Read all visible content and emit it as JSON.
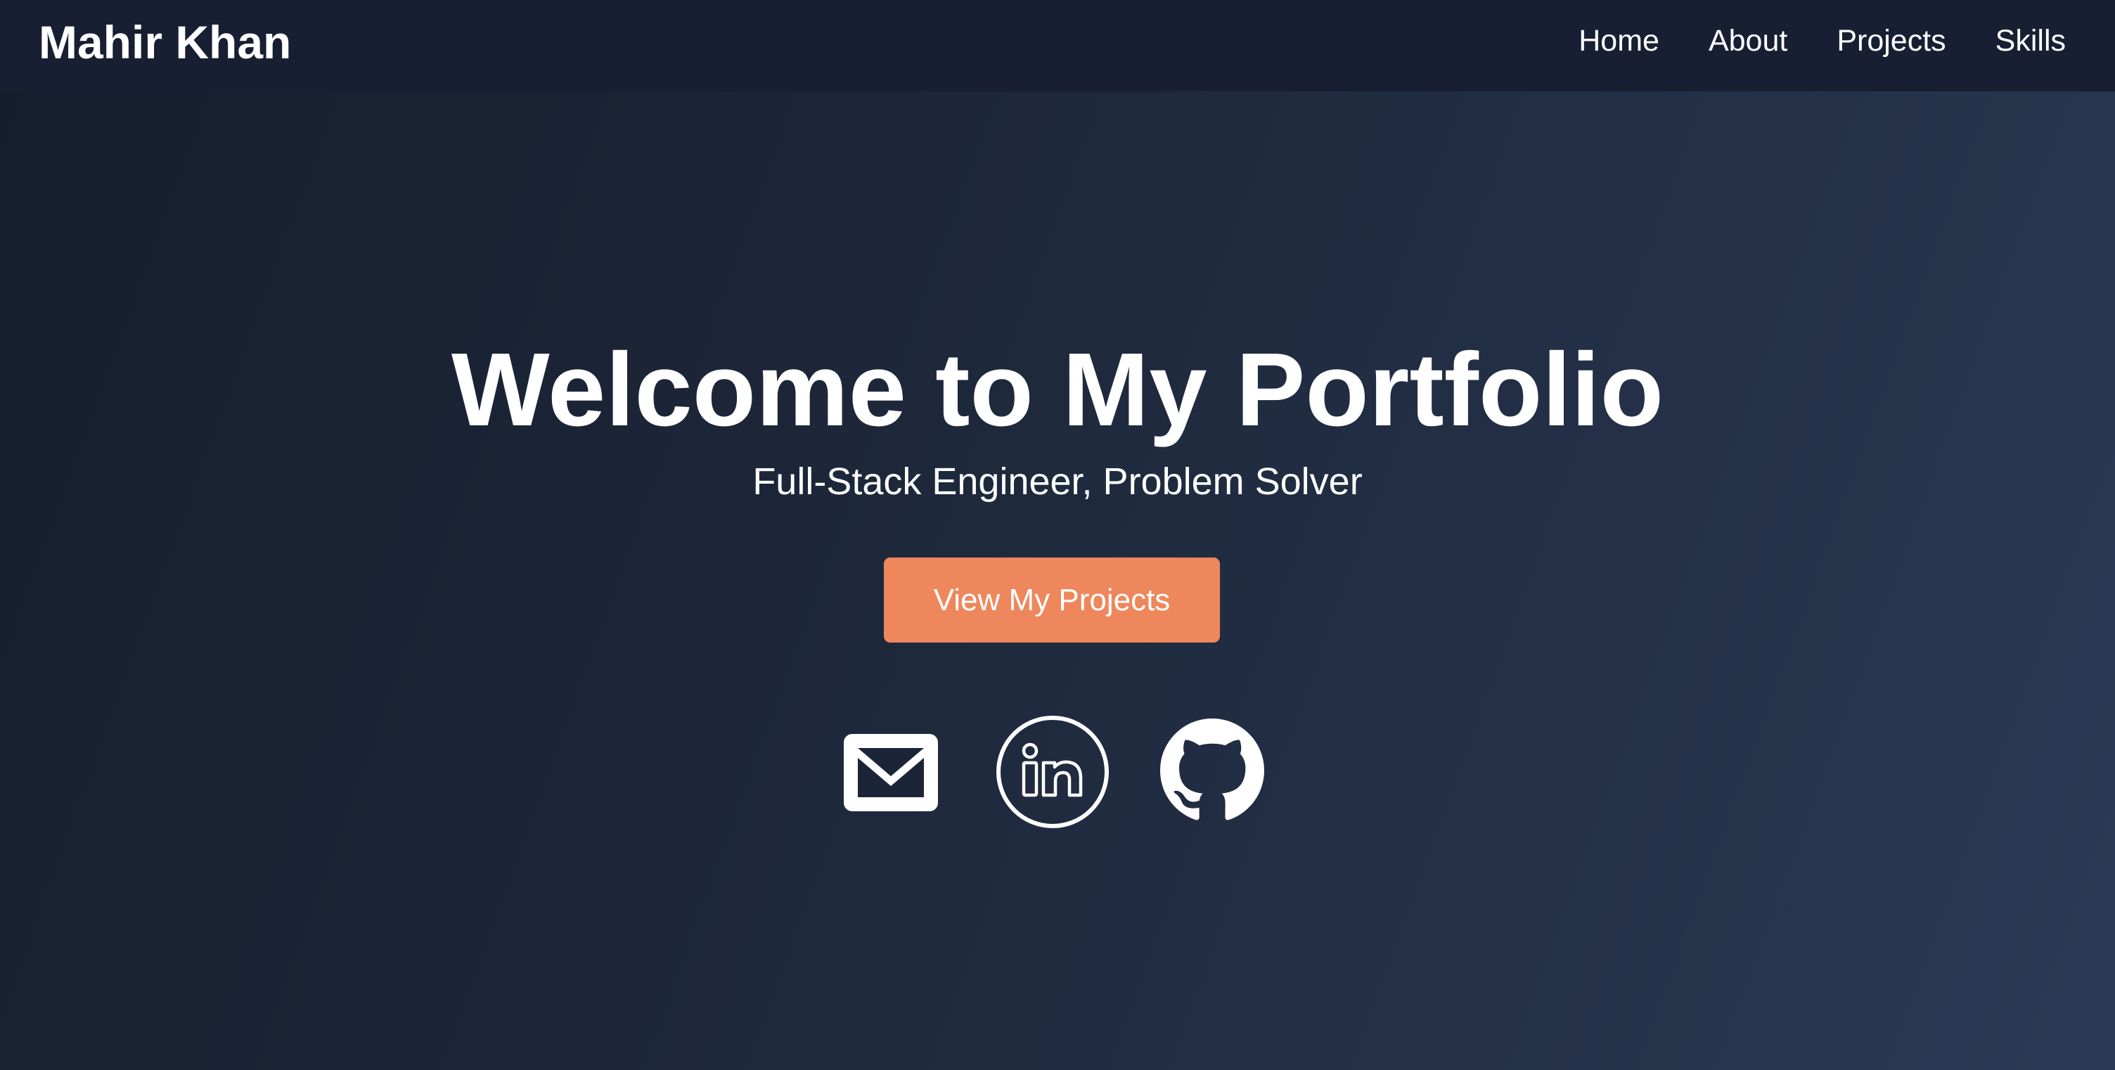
{
  "navbar": {
    "brand": "Mahir Khan",
    "links": [
      "Home",
      "About",
      "Projects",
      "Skills"
    ]
  },
  "hero": {
    "title": "Welcome to My Portfolio",
    "subtitle": "Full-Stack Engineer, Problem Solver",
    "cta_label": "View My Projects"
  },
  "social": {
    "icons": [
      "mail-icon",
      "linkedin-icon",
      "github-icon"
    ]
  },
  "colors": {
    "navbar_bg": "#191f33",
    "page_bg_start": "#161d2e",
    "page_bg_end": "#2b3b55",
    "accent": "#ee875c",
    "text": "#ffffff"
  }
}
